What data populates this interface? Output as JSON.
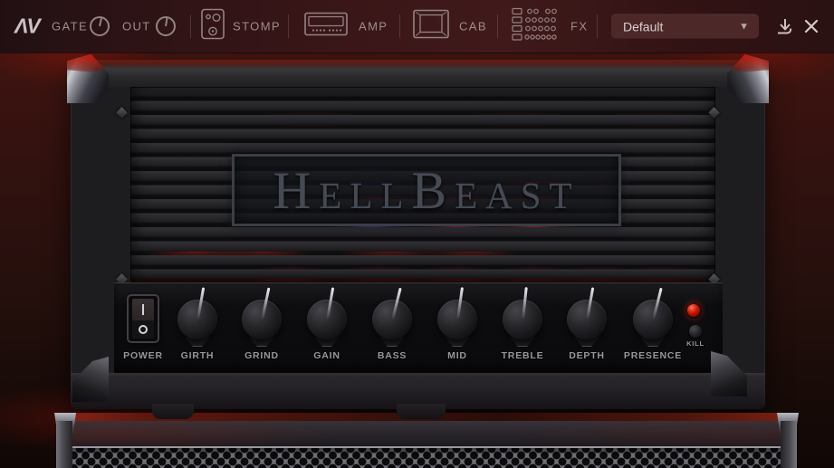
{
  "toolbar": {
    "logo_text": "ΛV",
    "gate_label": "GATE",
    "out_label": "OUT",
    "stomp_label": "STOMP",
    "amp_label": "AMP",
    "cab_label": "CAB",
    "fx_label": "FX",
    "preset": {
      "value": "Default",
      "arrow": "▼"
    },
    "icons": {
      "gate": "knob-icon",
      "out": "knob-icon",
      "stomp": "pedal-icon",
      "amp": "amp-head-icon",
      "cab": "cabinet-icon",
      "fx": "rack-icon",
      "download": "download-icon",
      "close": "close-icon"
    }
  },
  "amp": {
    "brand": "HellBeast",
    "power_switch": {
      "label": "POWER",
      "on_symbol": "I",
      "off_symbol": "O",
      "state": "on"
    },
    "knobs": [
      {
        "label": "GIRTH",
        "angle_deg": 10
      },
      {
        "label": "GRIND",
        "angle_deg": 12
      },
      {
        "label": "GAIN",
        "angle_deg": 10
      },
      {
        "label": "BASS",
        "angle_deg": 14
      },
      {
        "label": "MID",
        "angle_deg": 8
      },
      {
        "label": "TREBLE",
        "angle_deg": 6
      },
      {
        "label": "DEPTH",
        "angle_deg": 10
      },
      {
        "label": "PRESENCE",
        "angle_deg": 14
      }
    ],
    "kill_switch": {
      "label": "KILL"
    },
    "led": {
      "color": "#d01a08",
      "state": "dim"
    }
  },
  "colors": {
    "toolbar_bg": "#3a1618",
    "preset_bg": "#4d2829",
    "stage_red": "#3f1410",
    "panel_black": "#0a0a0c",
    "label_gray": "#97989c",
    "glow_red": "#ff3c23",
    "glow_blue": "#6e5aff",
    "glow_purple": "#c83ce6"
  }
}
